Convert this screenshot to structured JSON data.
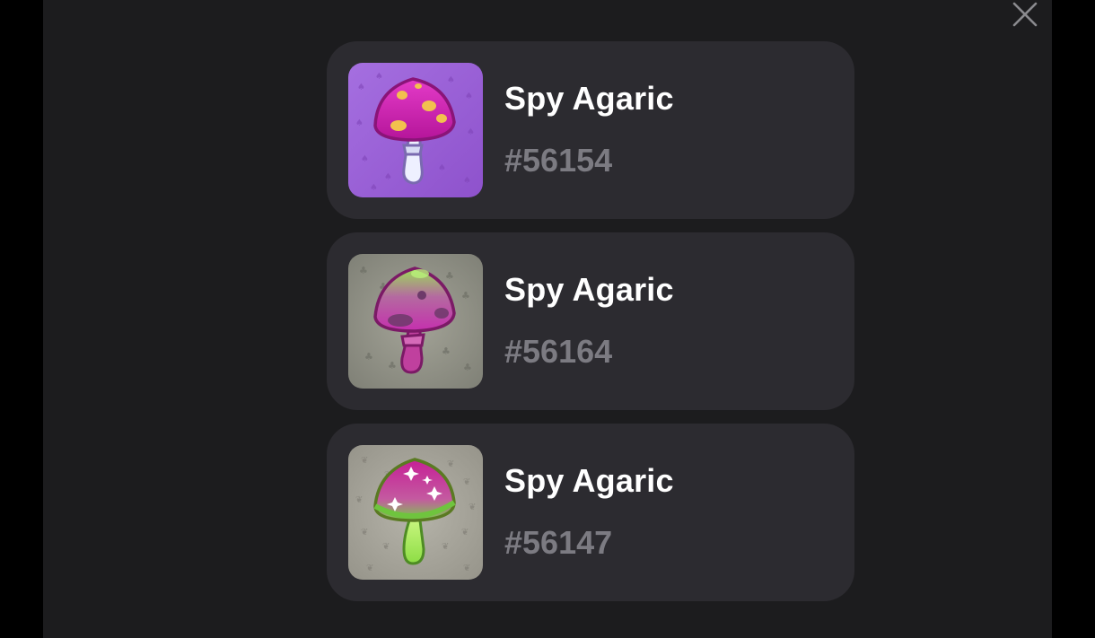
{
  "modal": {
    "close_icon": "close-icon"
  },
  "items": [
    {
      "name": "Spy Agaric",
      "id": "#56154",
      "image_icon": "mushroom-icon",
      "background_color": "#9b61d6",
      "cap_color": "#d91fb6",
      "spot_color": "#f2c14e",
      "stem_color": "#eef0ff"
    },
    {
      "name": "Spy Agaric",
      "id": "#56164",
      "image_icon": "mushroom-icon",
      "background_color": "#8f8f84",
      "cap_color": "#c23bb0",
      "cap_top_color": "#8fd14f",
      "stem_color": "#c0409e"
    },
    {
      "name": "Spy Agaric",
      "id": "#56147",
      "image_icon": "mushroom-icon",
      "background_color": "#a6a49a",
      "cap_color": "#c4289a",
      "cap_bottom_color": "#7cd34a",
      "stem_color": "#a6ea5c"
    }
  ]
}
